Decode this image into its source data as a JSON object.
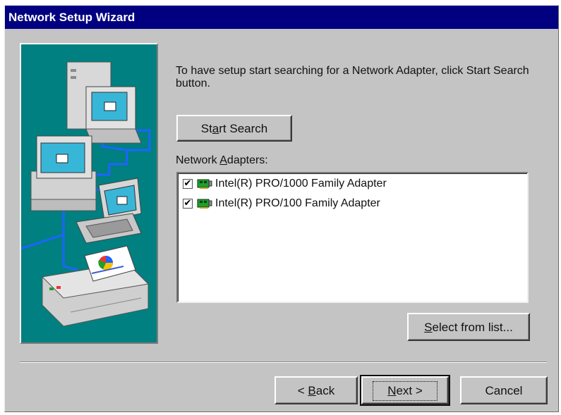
{
  "window": {
    "title": "Network Setup Wizard"
  },
  "instructions": "To have setup start searching for a Network Adapter, click Start Search button.",
  "start_search": {
    "label_pre": "St",
    "label_accel": "a",
    "label_post": "rt Search"
  },
  "adapters_label": {
    "pre": "Network ",
    "accel": "A",
    "post": "dapters:"
  },
  "adapters": [
    {
      "name": "Intel(R) PRO/1000 Family Adapter",
      "checked": true,
      "check_glyph": "✔",
      "icon": "network-card-icon"
    },
    {
      "name": "Intel(R) PRO/100 Family Adapter",
      "checked": true,
      "check_glyph": "✔",
      "icon": "network-card-icon"
    }
  ],
  "select_from_list": {
    "accel": "S",
    "post": "elect from list..."
  },
  "back_button": {
    "pre": "< ",
    "accel": "B",
    "post": "ack"
  },
  "next_button": {
    "accel": "N",
    "post": "ext >"
  },
  "cancel_button": {
    "label": "Cancel"
  },
  "colors": {
    "titlebar": "#000080",
    "dialog_face": "#c4c4c4",
    "image_background": "#008080",
    "network_cable": "#1e64ff",
    "card_green": "#1f9e2f"
  }
}
